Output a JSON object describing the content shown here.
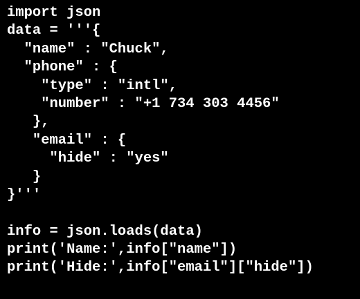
{
  "code": {
    "lines": [
      "import json",
      "data = '''{",
      "  \"name\" : \"Chuck\",",
      "  \"phone\" : {",
      "    \"type\" : \"intl\",",
      "    \"number\" : \"+1 734 303 4456\"",
      "   },",
      "   \"email\" : {",
      "     \"hide\" : \"yes\"",
      "   }",
      "}'''",
      "",
      "info = json.loads(data)",
      "print('Name:',info[\"name\"])",
      "print('Hide:',info[\"email\"][\"hide\"])"
    ]
  },
  "colors": {
    "background": "#000000",
    "text": "#ffffff"
  }
}
